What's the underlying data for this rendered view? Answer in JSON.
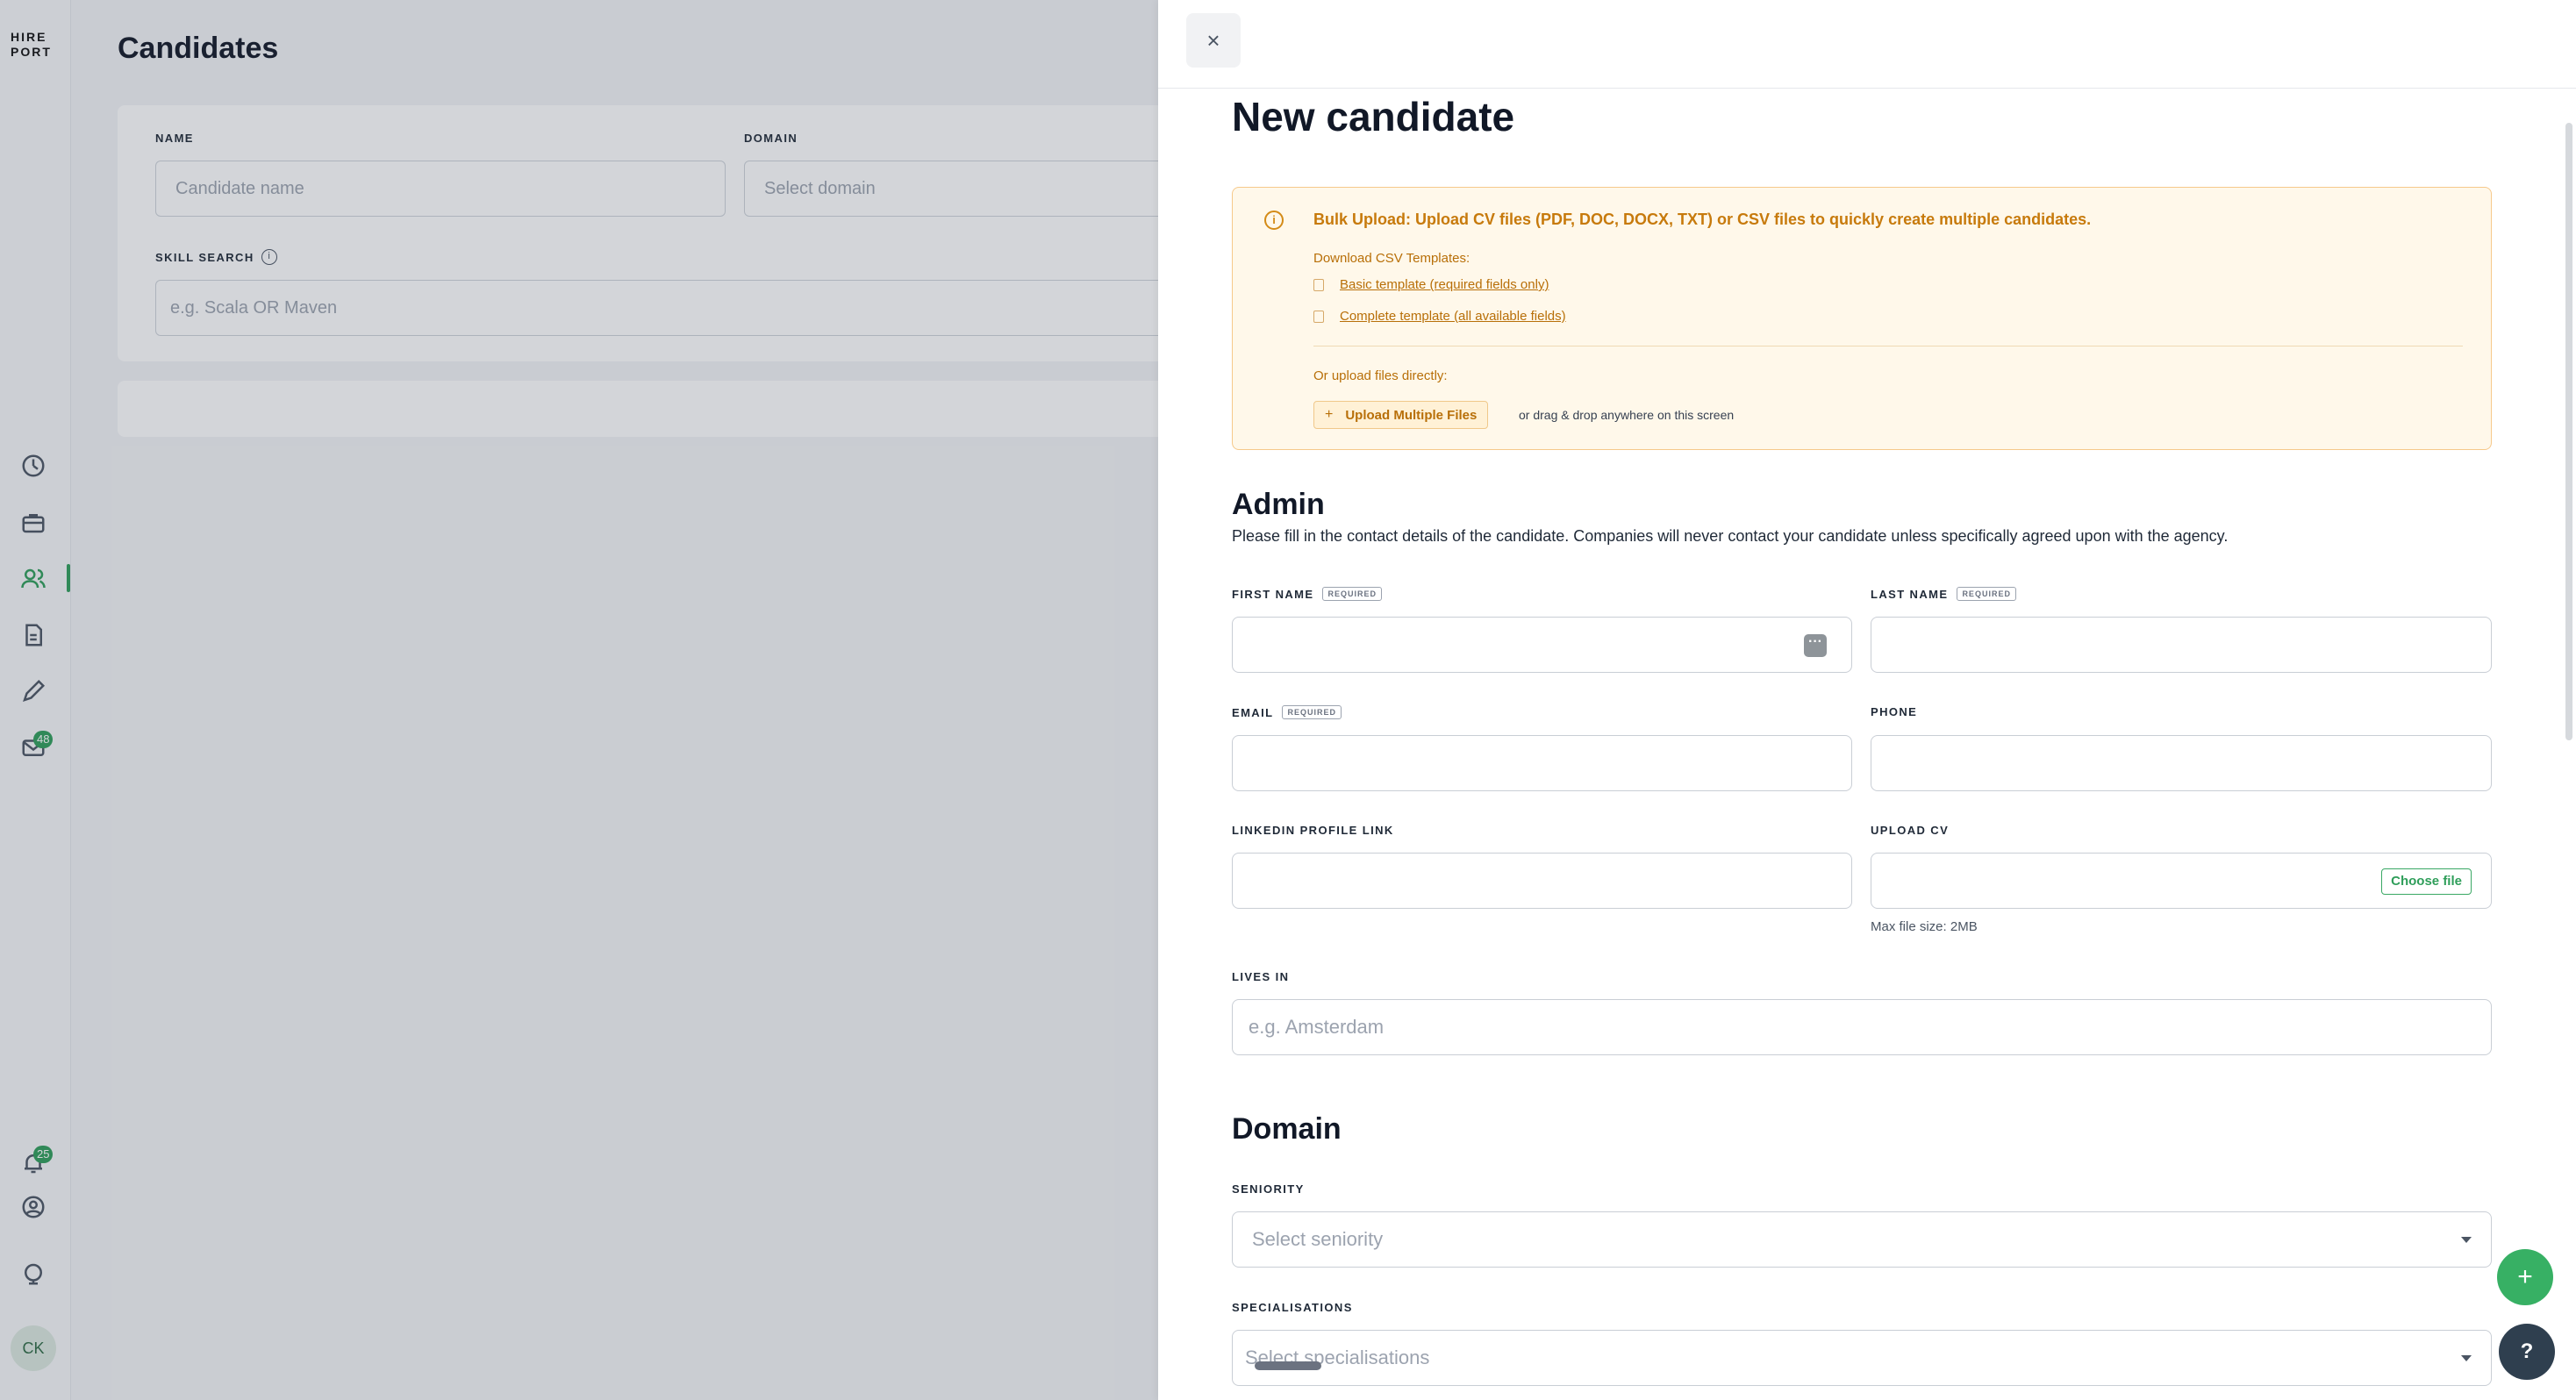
{
  "app": {
    "logo_line1": "HIRE",
    "logo_line2": "PORT"
  },
  "sidebar": {
    "badges": {
      "inbox": "48",
      "notifications": "25"
    },
    "avatar": "CK"
  },
  "main": {
    "title": "Candidates",
    "filters": {
      "name_label": "NAME",
      "name_placeholder": "Candidate name",
      "domain_label": "DOMAIN",
      "domain_placeholder": "Select domain",
      "skill_label": "SKILL SEARCH",
      "skill_placeholder": "e.g. Scala OR Maven"
    }
  },
  "panel": {
    "title": "New candidate",
    "bulk": {
      "headline_bold": "Bulk Upload:",
      "headline_rest": " Upload CV files (PDF, DOC, DOCX, TXT) or CSV files to quickly create multiple candidates.",
      "download_label": "Download CSV Templates:",
      "templates": [
        "Basic template (required fields only)",
        "Complete template (all available fields)"
      ],
      "or_upload": "Or upload files directly:",
      "upload_button": "Upload Multiple Files",
      "drag_note": "or drag & drop anywhere on this screen"
    },
    "admin": {
      "title": "Admin",
      "description": "Please fill in the contact details of the candidate. Companies will never contact your candidate unless specifically agreed upon with the agency.",
      "required_tag": "REQUIRED",
      "first_name_label": "FIRST NAME",
      "last_name_label": "LAST NAME",
      "email_label": "EMAIL",
      "phone_label": "PHONE",
      "linkedin_label": "LINKEDIN PROFILE LINK",
      "upload_cv_label": "UPLOAD CV",
      "choose_file": "Choose file",
      "max_size": "Max file size: 2MB",
      "lives_in_label": "LIVES IN",
      "lives_in_placeholder": "e.g. Amsterdam"
    },
    "domain": {
      "title": "Domain",
      "seniority_label": "SENIORITY",
      "seniority_placeholder": "Select seniority",
      "specialisations_label": "SPECIALISATIONS",
      "specialisations_placeholder": "Select specialisations"
    }
  },
  "fabs": {
    "add": "+",
    "help": "?"
  }
}
